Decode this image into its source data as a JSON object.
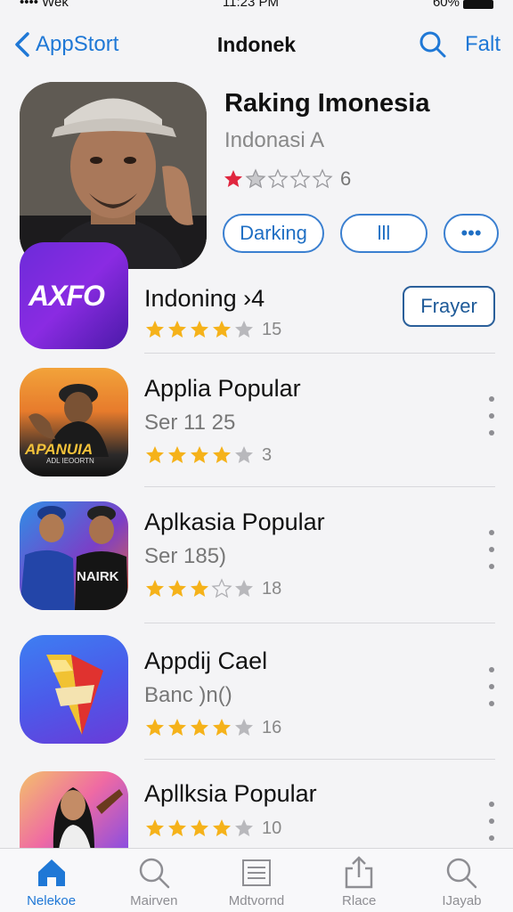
{
  "status_bar": {
    "left": "•••• Wek",
    "time": "11:23 PM",
    "right": "60%"
  },
  "nav": {
    "back_label": "AppStort",
    "title": "Indonek",
    "right_label": "Falt"
  },
  "featured": {
    "title": "Raking Imonesia",
    "subtitle": "Indonasi A",
    "rating": 1,
    "rating_count": "6",
    "buttons": [
      "Darking",
      "lll",
      "•••"
    ]
  },
  "apps": [
    {
      "name": "Indoning ›4",
      "sub": "",
      "rating": 4,
      "rating_count": "15",
      "action": "Frayer",
      "icon_text": "AXFO"
    },
    {
      "name": "Applia Popular",
      "sub": "Ser 11 25",
      "rating": 4,
      "rating_count": "3",
      "icon_text": "APANUIA",
      "icon_sub": "ADL IEOORTN"
    },
    {
      "name": "Aplkasia Popular",
      "sub": "Ser 185)",
      "rating": 3.5,
      "rating_count": "18",
      "icon_text": "NAIRK"
    },
    {
      "name": "Appdij Cael",
      "sub": "Banc )n()",
      "rating": 4,
      "rating_count": "16",
      "icon_text": ""
    },
    {
      "name": "Apllksia Popular",
      "sub": "",
      "rating": 4,
      "rating_count": "10",
      "icon_text": ""
    }
  ],
  "tabs": [
    {
      "label": "Nelekoe",
      "icon": "home-icon",
      "active": true
    },
    {
      "label": "Mairven",
      "icon": "search-icon",
      "active": false
    },
    {
      "label": "Mdtvornd",
      "icon": "list-icon",
      "active": false
    },
    {
      "label": "Rlace",
      "icon": "share-icon",
      "active": false
    },
    {
      "label": "IJayab",
      "icon": "search-icon",
      "active": false
    }
  ],
  "colors": {
    "accent": "#1f78d6",
    "star": "#f5b21a",
    "star_red": "#e0263f"
  }
}
